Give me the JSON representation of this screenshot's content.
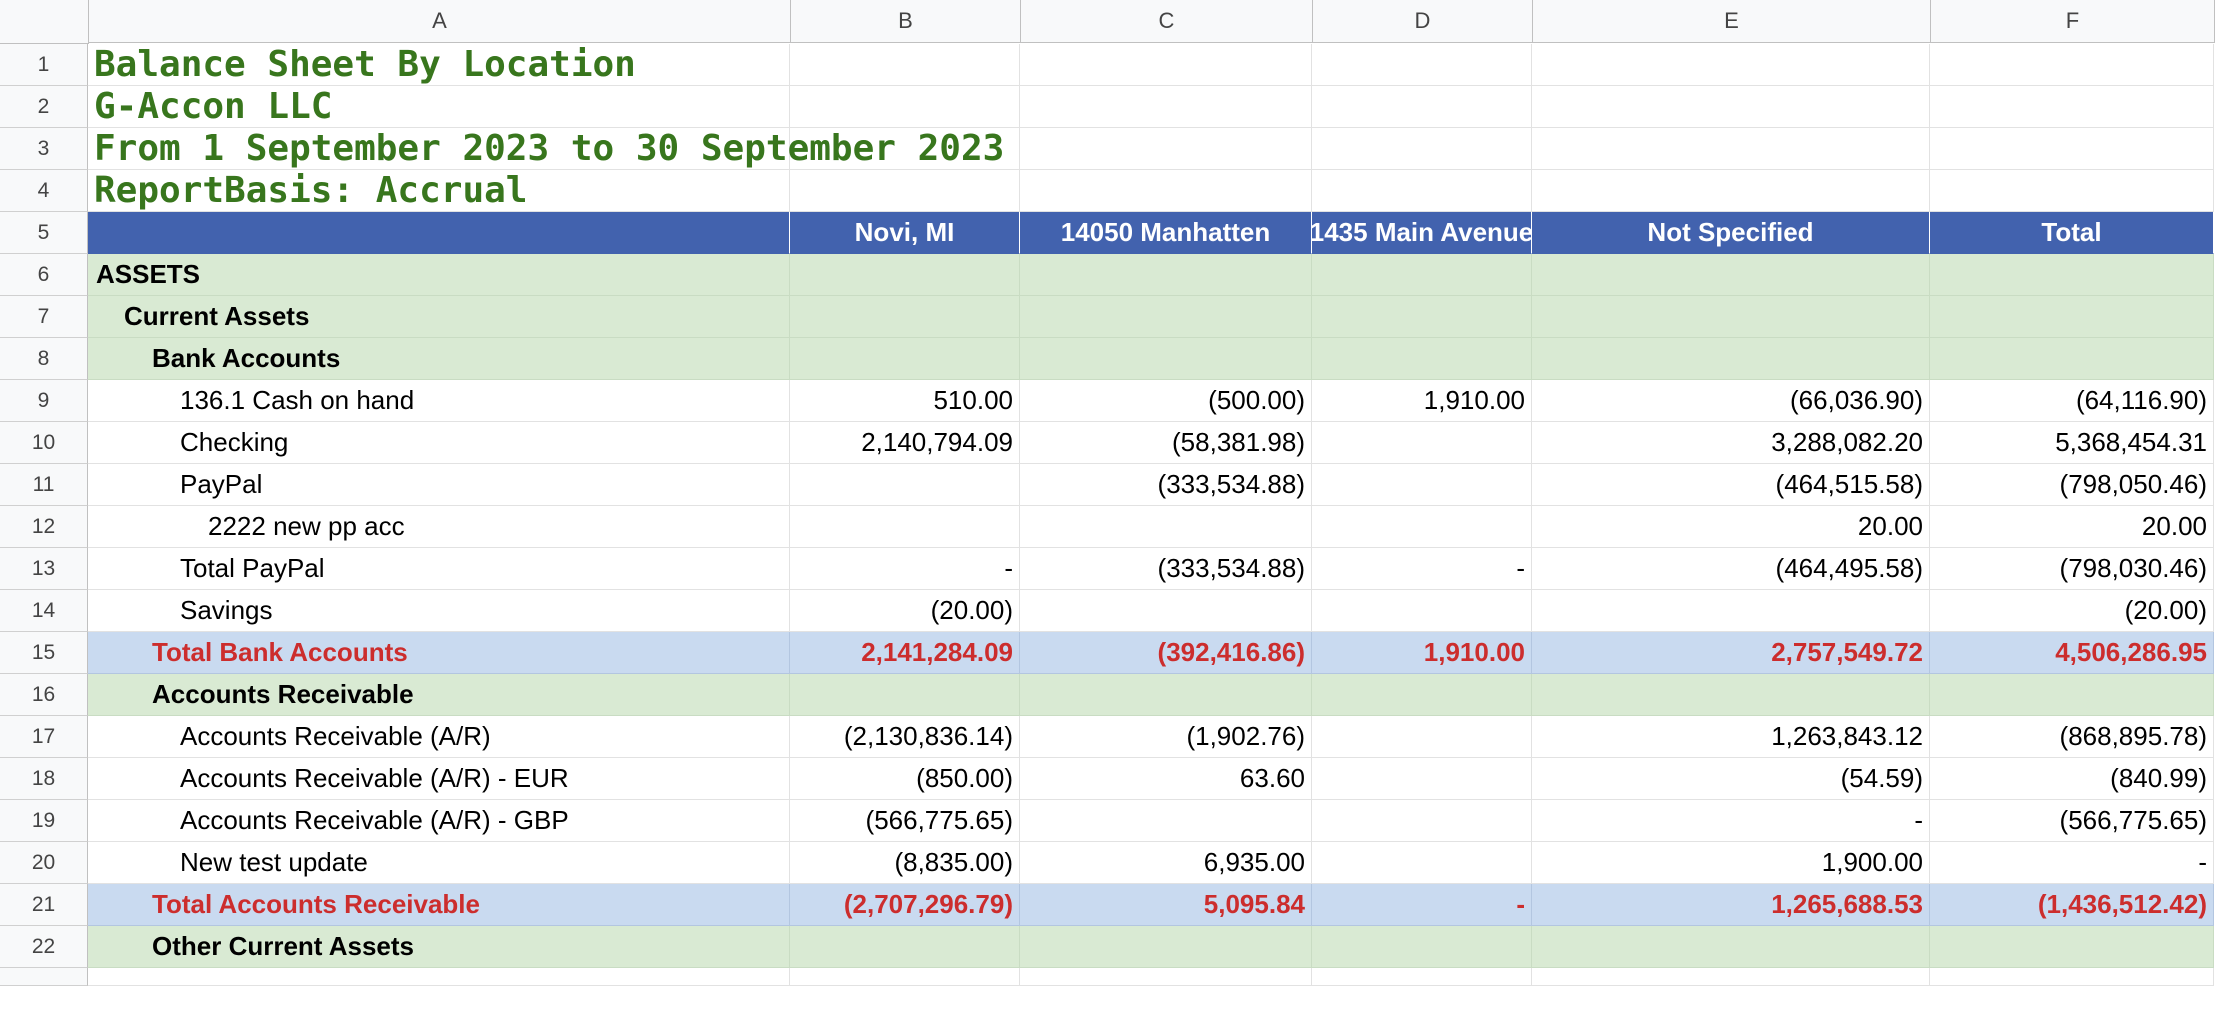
{
  "columns": [
    "A",
    "B",
    "C",
    "D",
    "E",
    "F"
  ],
  "rows": [
    {
      "n": "1",
      "type": "title",
      "cells": [
        "Balance Sheet By Location",
        "",
        "",
        "",
        "",
        ""
      ]
    },
    {
      "n": "2",
      "type": "title",
      "cells": [
        "G-Accon LLC",
        "",
        "",
        "",
        "",
        ""
      ]
    },
    {
      "n": "3",
      "type": "title",
      "cells": [
        "From 1 September 2023 to 30 September 2023",
        "",
        "",
        "",
        "",
        ""
      ]
    },
    {
      "n": "4",
      "type": "title",
      "cells": [
        "ReportBasis: Accrual",
        "",
        "",
        "",
        "",
        ""
      ]
    },
    {
      "n": "5",
      "type": "hdr",
      "cells": [
        "",
        "Novi, MI",
        "14050 Manhatten",
        "1435 Main Avenue",
        "Not Specified",
        "Total"
      ]
    },
    {
      "n": "6",
      "type": "sec",
      "indent": 0,
      "cells": [
        "ASSETS",
        "",
        "",
        "",
        "",
        ""
      ]
    },
    {
      "n": "7",
      "type": "sec",
      "indent": 1,
      "cells": [
        "Current Assets",
        "",
        "",
        "",
        "",
        ""
      ]
    },
    {
      "n": "8",
      "type": "sec",
      "indent": 2,
      "cells": [
        "Bank Accounts",
        "",
        "",
        "",
        "",
        ""
      ]
    },
    {
      "n": "9",
      "type": "data",
      "indent": 3,
      "cells": [
        "136.1 Cash on hand",
        "510.00",
        "(500.00)",
        "1,910.00",
        "(66,036.90)",
        "(64,116.90)"
      ]
    },
    {
      "n": "10",
      "type": "data",
      "indent": 3,
      "cells": [
        "Checking",
        "2,140,794.09",
        "(58,381.98)",
        "",
        "3,288,082.20",
        "5,368,454.31"
      ]
    },
    {
      "n": "11",
      "type": "data",
      "indent": 3,
      "cells": [
        "PayPal",
        "",
        "(333,534.88)",
        "",
        "(464,515.58)",
        "(798,050.46)"
      ]
    },
    {
      "n": "12",
      "type": "data",
      "indent": 4,
      "cells": [
        "2222 new pp acc",
        "",
        "",
        "",
        "20.00",
        "20.00"
      ]
    },
    {
      "n": "13",
      "type": "data",
      "indent": 3,
      "cells": [
        "Total PayPal",
        "-",
        "(333,534.88)",
        "-",
        "(464,495.58)",
        "(798,030.46)"
      ]
    },
    {
      "n": "14",
      "type": "data",
      "indent": 3,
      "cells": [
        "Savings",
        "(20.00)",
        "",
        "",
        "",
        "(20.00)"
      ]
    },
    {
      "n": "15",
      "type": "tot",
      "indent": 2,
      "cells": [
        "Total Bank Accounts",
        "2,141,284.09",
        "(392,416.86)",
        "1,910.00",
        "2,757,549.72",
        "4,506,286.95"
      ]
    },
    {
      "n": "16",
      "type": "sec",
      "indent": 2,
      "cells": [
        "Accounts Receivable",
        "",
        "",
        "",
        "",
        ""
      ]
    },
    {
      "n": "17",
      "type": "data",
      "indent": 3,
      "cells": [
        "Accounts Receivable (A/R)",
        "(2,130,836.14)",
        "(1,902.76)",
        "",
        "1,263,843.12",
        "(868,895.78)"
      ]
    },
    {
      "n": "18",
      "type": "data",
      "indent": 3,
      "cells": [
        "Accounts Receivable (A/R) - EUR",
        "(850.00)",
        "63.60",
        "",
        "(54.59)",
        "(840.99)"
      ]
    },
    {
      "n": "19",
      "type": "data",
      "indent": 3,
      "cells": [
        "Accounts Receivable (A/R) - GBP",
        "(566,775.65)",
        "",
        "",
        "-",
        "(566,775.65)"
      ]
    },
    {
      "n": "20",
      "type": "data",
      "indent": 3,
      "cells": [
        "New test update",
        "(8,835.00)",
        "6,935.00",
        "",
        "1,900.00",
        "-"
      ]
    },
    {
      "n": "21",
      "type": "tot",
      "indent": 2,
      "cells": [
        "Total Accounts Receivable",
        "(2,707,296.79)",
        "5,095.84",
        "-",
        "1,265,688.53",
        "(1,436,512.42)"
      ]
    },
    {
      "n": "22",
      "type": "sec",
      "indent": 2,
      "cells": [
        "Other Current Assets",
        "",
        "",
        "",
        "",
        ""
      ]
    }
  ]
}
